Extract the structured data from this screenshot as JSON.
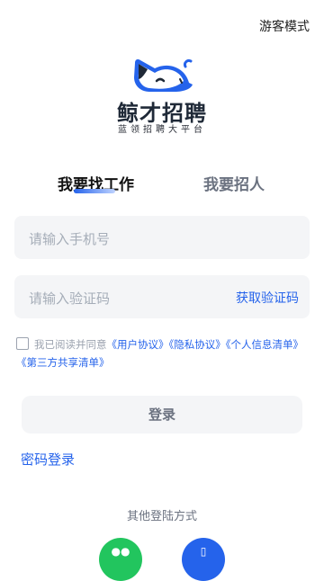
{
  "header": {
    "guest_mode": "游客模式"
  },
  "brand": {
    "name": "鲸才招聘",
    "slogan": "蓝领招聘大平台"
  },
  "tabs": {
    "find_job": "我要找工作",
    "hire": "我要招人"
  },
  "form": {
    "phone_placeholder": "请输入手机号",
    "code_placeholder": "请输入验证码",
    "get_code": "获取验证码"
  },
  "agreement": {
    "prefix": "我已阅读并同意",
    "user": "《用户协议》",
    "privacy": "《隐私协议》",
    "personal": "《个人信息清单》",
    "third_party": "《第三方共享清单》"
  },
  "actions": {
    "login": "登录",
    "password_login": "密码登录"
  },
  "other_login": {
    "title": "其他登陆方式"
  },
  "colors": {
    "accent": "#2563eb",
    "wechat": "#22c55e",
    "field_bg": "#f4f5f7"
  }
}
